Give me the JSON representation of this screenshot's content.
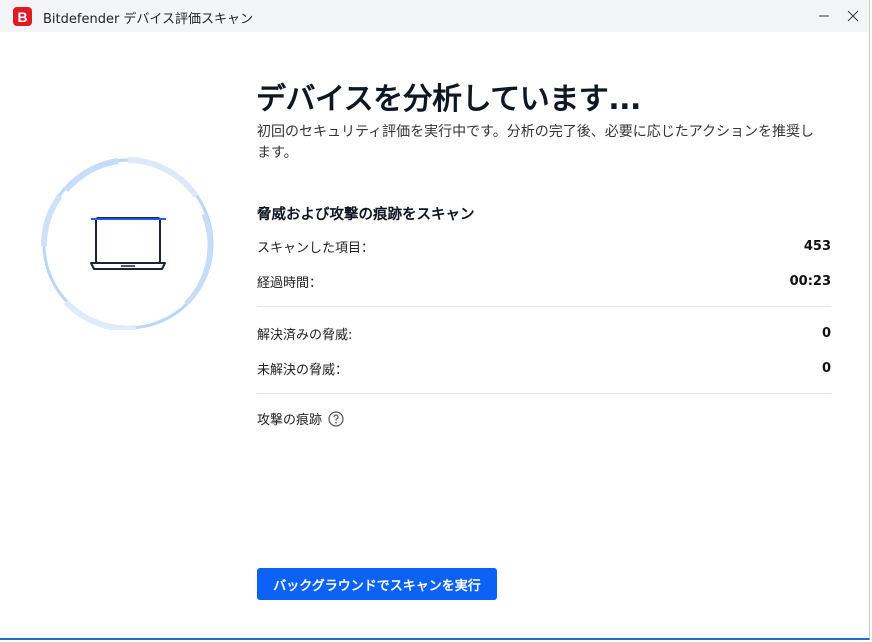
{
  "window": {
    "title": "Bitdefender デバイス評価スキャン",
    "logo_letter": "B",
    "accent_color": "#e11a27"
  },
  "main": {
    "heading": "デバイスを分析しています...",
    "description": "初回のセキュリティ評価を実行中です。分析の完了後、必要に応じたアクションを推奨します。",
    "section_title": "脅威および攻撃の痕跡をスキャン",
    "stats": [
      {
        "label": "スキャンした項目：",
        "value": "453"
      },
      {
        "label": "経過時間：",
        "value": "00:23"
      },
      {
        "label": "解決済みの脅威:",
        "value": "0"
      },
      {
        "label": "未解決の脅威：",
        "value": "0"
      }
    ],
    "attack_traces_label": "攻撃の痕跡",
    "background_button_label": "バックグラウンドでスキャンを実行",
    "button_color": "#0b62f5"
  }
}
